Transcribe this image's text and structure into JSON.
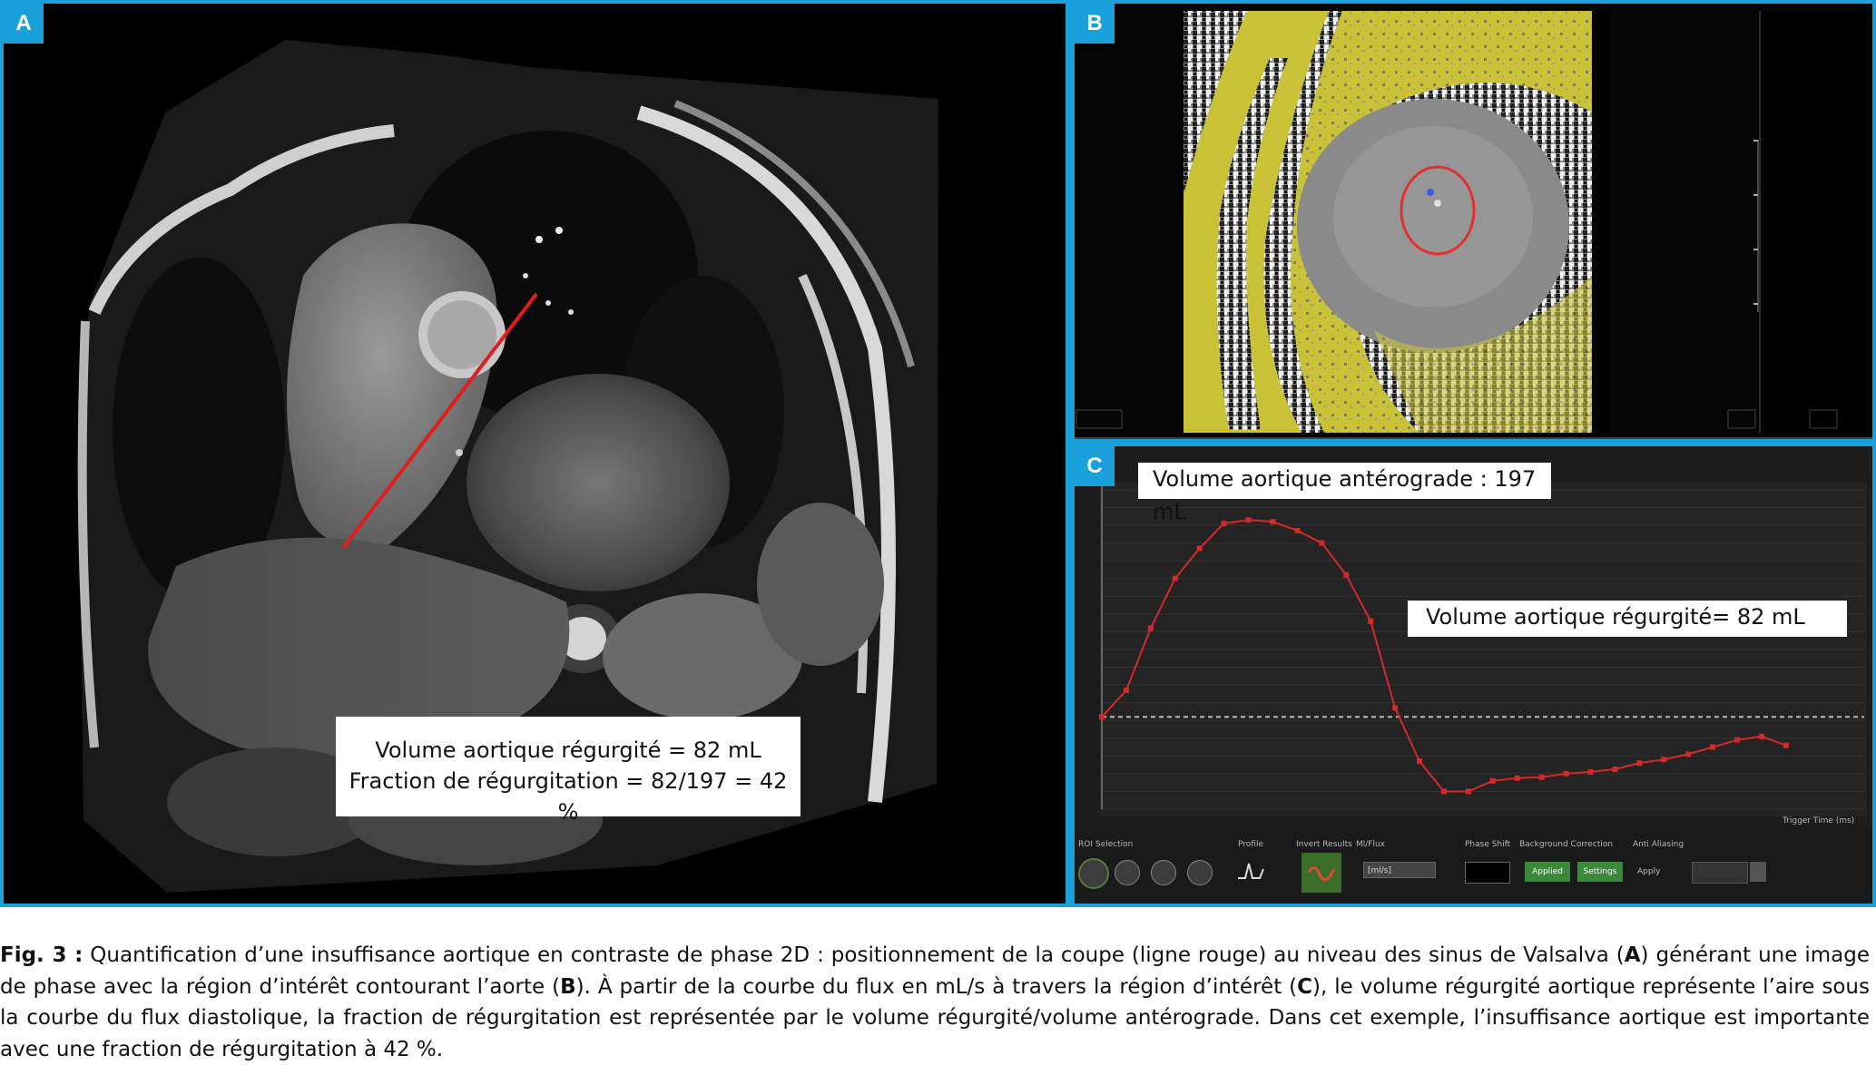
{
  "figure": {
    "panels": {
      "a": {
        "letter": "A"
      },
      "b": {
        "letter": "B"
      },
      "c": {
        "letter": "C"
      }
    },
    "box_a": {
      "line1": "Volume aortique régurgité = 82 mL",
      "line2": "Fraction de régurgitation = 82/197 = 42 %"
    },
    "box_c": {
      "antegrade": "Volume aortique antérograde : 197 mL",
      "regurgitant": "Volume aortique régurgité= 82 mL"
    },
    "controls": {
      "roi_selection": "ROI Selection",
      "profile": "Profile",
      "invert_results": "Invert Results",
      "ml_flow": "Ml/Flux",
      "phase_shift": "Phase Shift",
      "background_correction": "Background Correction",
      "anti_aliasing": "Anti Aliasing",
      "unit_select": "[ml/s]",
      "applied_button": "Applied",
      "settings_button": "Settings",
      "apply": "Apply",
      "trigger_time": "Trigger Time (ms)"
    },
    "colors": {
      "accent": "#1aa0db",
      "flow_curve": "#d42a2a",
      "roi": "#e23030",
      "mask": "#c9c237"
    }
  },
  "chart_data": {
    "type": "line",
    "series": [
      {
        "values": [
          [
            0,
            0
          ],
          [
            25,
            150
          ],
          [
            50,
            500
          ],
          [
            75,
            780
          ],
          [
            100,
            950
          ],
          [
            125,
            1090
          ],
          [
            150,
            1110
          ],
          [
            175,
            1100
          ],
          [
            200,
            1050
          ],
          [
            225,
            980
          ],
          [
            250,
            800
          ],
          [
            275,
            540
          ],
          [
            300,
            50
          ],
          [
            325,
            -250
          ],
          [
            350,
            -420
          ],
          [
            375,
            -420
          ],
          [
            400,
            -360
          ],
          [
            425,
            -345
          ],
          [
            450,
            -340
          ],
          [
            475,
            -320
          ],
          [
            500,
            -310
          ],
          [
            525,
            -295
          ],
          [
            550,
            -260
          ],
          [
            575,
            -240
          ],
          [
            600,
            -210
          ],
          [
            625,
            -170
          ],
          [
            650,
            -130
          ],
          [
            675,
            -110
          ],
          [
            700,
            -160
          ]
        ]
      }
    ],
    "xlim": [
      0,
      780
    ],
    "ylim": [
      -520,
      1300
    ],
    "grid": true
  },
  "caption": {
    "label": "Fig. 3 :",
    "p1": " Quantification d’une insuffisance aortique en contraste de phase 2D : positionnement de la coupe (ligne rouge) au niveau des sinus de Valsalva (",
    "a": "A",
    "p2": ") générant une image de phase avec la région d’intérêt contourant l’aorte (",
    "b": "B",
    "p3": "). À partir de la courbe du flux en mL/s à travers la région d’intérêt (",
    "c": "C",
    "p4": "), le volume régurgité aortique représente l’aire sous la courbe du flux diastolique, la fraction de régurgitation est représentée par le volume régurgité/volume antérograde. Dans cet exemple, l’insuffisance aortique est importante avec une fraction de régurgitation à 42 %."
  }
}
